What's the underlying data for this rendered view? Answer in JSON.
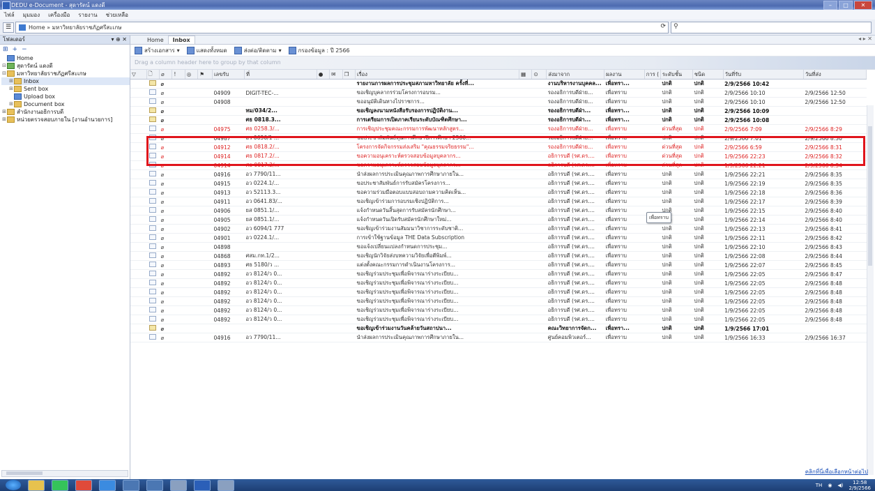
{
  "window": {
    "title": "DEDU e-Document - สุดารัตน์ แดงดี"
  },
  "menu": [
    "ไฟล์",
    "มุมมอง",
    "เครื่องมือ",
    "รายงาน",
    "ช่วยเหลือ"
  ],
  "address": {
    "path": "Home » มหาวิทยาลัยราชภัฏศรีสะเกษ",
    "search_placeholder": ""
  },
  "sidebar": {
    "title": "โฟลเดอร์",
    "tree": [
      {
        "label": "Home",
        "level": 0,
        "type": "home"
      },
      {
        "label": "สุดารัตน์ แดงดี",
        "level": 0,
        "type": "user"
      },
      {
        "label": "มหาวิทยาลัยราชภัฏศรีสะเกษ",
        "level": 0,
        "type": "org"
      },
      {
        "label": "Inbox",
        "level": 1,
        "type": "folder",
        "selected": true
      },
      {
        "label": "Sent box",
        "level": 1,
        "type": "folder"
      },
      {
        "label": "Upload box",
        "level": 1,
        "type": "folder"
      },
      {
        "label": "Document box",
        "level": 1,
        "type": "folder"
      },
      {
        "label": "สำนักงานอธิการบดี",
        "level": 0,
        "type": "org"
      },
      {
        "label": "หน่วยตรวจสอบภายใน [งานอำนวยการ]",
        "level": 0,
        "type": "org"
      }
    ]
  },
  "tabs": [
    {
      "label": "Home"
    },
    {
      "label": "Inbox"
    }
  ],
  "toolbar": {
    "action1": "สร้างเอกสาร",
    "action2": "แสดงทั้งหมด",
    "action3": "ส่งต่อ/ติดตาม",
    "action4": "กรองข้อมูล : ปี 2566"
  },
  "group_hint": "Drag a column header here to group by that column",
  "columns": [
    "",
    "",
    "",
    "!",
    "",
    "",
    "เลขรับ",
    "ที่",
    "",
    "",
    "",
    "เรื่อง",
    "",
    "",
    "ส่งมาจาก",
    "ผลงาน",
    "การ (",
    "ระดับชั้น",
    "ชนิด",
    "วันที่รับ",
    "วันที่ส่ง"
  ],
  "rows": [
    {
      "style": "bold",
      "icon": "open",
      "regno": "",
      "docno": "",
      "subject": "รายงานการผลการประชุมสภามหาวิทยาลัย ครั้งที่...",
      "from": "งานบริหารงานบุคคล...",
      "dept": "เพื่อทรา...",
      "level": "ปกติ",
      "type": "ปกติ",
      "recv": "2/9/2566 10:42",
      "sent": ""
    },
    {
      "style": "",
      "icon": "mail",
      "regno": "04909",
      "docno": "DIGIT-TEC-...",
      "subject": "ขอเชิญบุคลากรร่วมโครงการอบรม...",
      "from": "รองอธิการบดีฝ่าย...",
      "dept": "เพื่อทราบ",
      "level": "ปกติ",
      "type": "ปกติ",
      "recv": "2/9/2566 10:10",
      "sent": "2/9/2566 12:50"
    },
    {
      "style": "",
      "icon": "mail",
      "regno": "04908",
      "docno": "",
      "subject": "ขออนุมัติเดินทางไปราชการ...",
      "from": "รองอธิการบดีฝ่าย...",
      "dept": "เพื่อทราบ",
      "level": "ปกติ",
      "type": "ปกติ",
      "recv": "2/9/2566 10:10",
      "sent": "2/9/2566 12:50"
    },
    {
      "style": "bold",
      "icon": "open",
      "regno": "",
      "docno": "ทม/034/2...",
      "subject": "ขอเชิญลงนามหนังสือรับรองการปฏิบัติงาน...",
      "from": "รองอธิการบดีฝ่า...",
      "dept": "เพื่อทรา...",
      "level": "ปกติ",
      "type": "ปกติ",
      "recv": "2/9/2566 10:09",
      "sent": ""
    },
    {
      "style": "bold",
      "icon": "open",
      "regno": "",
      "docno": "ศธ 0818.3...",
      "subject": "การเตรียมการเปิดภาคเรียนระดับบัณฑิตศึกษา...",
      "from": "รองอธิการบดีฝ่า...",
      "dept": "เพื่อทรา...",
      "level": "ปกติ",
      "type": "ปกติ",
      "recv": "2/9/2566 10:08",
      "sent": ""
    },
    {
      "style": "red",
      "icon": "mail",
      "regno": "04975",
      "docno": "ศธ 0258.3/...",
      "subject": "การเชิญประชุมคณะกรรมการพัฒนาหลักสูตร...",
      "from": "รองอธิการบดีฝ่าย...",
      "dept": "เพื่อทราบ",
      "level": "ด่วนที่สุด",
      "type": "ปกติ",
      "recv": "2/9/2566 7:09",
      "sent": "2/9/2566 8:29"
    },
    {
      "style": "",
      "icon": "mail",
      "regno": "04987",
      "docno": "อว 0636/1 ...",
      "subject": "ขอประชาสัมพันธ์ทุนการศึกษาปีการศึกษา 2566...",
      "from": "รองอธิการบดีฝ่าย...",
      "dept": "เพื่อทราบ",
      "level": "ปกติ",
      "type": "ปกติ",
      "recv": "2/9/2566 7:01",
      "sent": "2/9/2566 8:30"
    },
    {
      "style": "red",
      "icon": "mail",
      "regno": "04912",
      "docno": "ศธ 0818.2/...",
      "subject": "โครงการจัดกิจกรรมส่งเสริม \"คุณธรรมจริยธรรม\"...",
      "from": "รองอธิการบดีฝ่าย...",
      "dept": "เพื่อทราบ",
      "level": "ด่วนที่สุด",
      "type": "ปกติ",
      "recv": "2/9/2566 6:59",
      "sent": "2/9/2566 8:31"
    },
    {
      "style": "red",
      "icon": "mail",
      "regno": "04914",
      "docno": "ศธ 0817.2/...",
      "subject": "ขอความอนุเคราะห์ตรวจสอบข้อมูลบุคลากร...",
      "from": "อธิการบดี (รศ.ดร....",
      "dept": "เพื่อทราบ",
      "level": "ด่วนที่สุด",
      "type": "ปกติ",
      "recv": "1/9/2566 22:23",
      "sent": "2/9/2566 8:32"
    },
    {
      "style": "red",
      "icon": "mail",
      "regno": "04914",
      "docno": "ศธ 0817.2/...",
      "subject": "ขอความอนุเคราะห์ตรวจสอบข้อมูลบุคลากร...",
      "from": "อธิการบดี (รศ.ดร....",
      "dept": "เพื่อทราบ",
      "level": "ด่วนที่สุด",
      "type": "ปกติ",
      "recv": "1/9/2566 22:21",
      "sent": "2/9/2566 8:34"
    },
    {
      "style": "",
      "icon": "mail",
      "regno": "04916",
      "docno": "อว 7790/11...",
      "subject": "นำส่งผลการประเมินคุณภาพการศึกษาภายใน...",
      "from": "อธิการบดี (รศ.ดร....",
      "dept": "เพื่อทราบ",
      "level": "ปกติ",
      "type": "ปกติ",
      "recv": "1/9/2566 22:21",
      "sent": "2/9/2566 8:35"
    },
    {
      "style": "",
      "icon": "mail",
      "regno": "04915",
      "docno": "อว 0224.1/...",
      "subject": "ขอประชาสัมพันธ์การรับสมัครโครงการ...",
      "from": "อธิการบดี (รศ.ดร....",
      "dept": "เพื่อทราบ",
      "level": "ปกติ",
      "type": "ปกติ",
      "recv": "1/9/2566 22:19",
      "sent": "2/9/2566 8:35"
    },
    {
      "style": "",
      "icon": "mail",
      "regno": "04913",
      "docno": "อว 52113.3...",
      "subject": "ขอความร่วมมือตอบแบบสอบถามความคิดเห็น...",
      "from": "อธิการบดี (รศ.ดร....",
      "dept": "เพื่อทราบ",
      "level": "ปกติ",
      "type": "ปกติ",
      "recv": "1/9/2566 22:18",
      "sent": "2/9/2566 8:36"
    },
    {
      "style": "",
      "icon": "mail",
      "regno": "04911",
      "docno": "อว 0641.83/...",
      "subject": "ขอเชิญเข้าร่วมการอบรมเชิงปฏิบัติการ...",
      "from": "อธิการบดี (รศ.ดร....",
      "dept": "เพื่อทราบ",
      "level": "ปกติ",
      "type": "ปกติ",
      "recv": "1/9/2566 22:17",
      "sent": "2/9/2566 8:39"
    },
    {
      "style": "",
      "icon": "mail",
      "regno": "04906",
      "docno": "ยส 0851.1/...",
      "subject": "แจ้งกำหนดวันสิ้นสุดการรับสมัครนักศึกษา...",
      "from": "อธิการบดี (รศ.ดร....",
      "dept": "เพื่อทราบ",
      "level": "ปกติ",
      "type": "ปกติ",
      "recv": "1/9/2566 22:15",
      "sent": "2/9/2566 8:40"
    },
    {
      "style": "",
      "icon": "mail",
      "regno": "04905",
      "docno": "ยส 0851.1/...",
      "subject": "แจ้งกำหนดวันเปิดรับสมัครนักศึกษาใหม่...",
      "from": "อธิการบดี (รศ.ดร....",
      "dept": "เพื่อทราบ",
      "level": "ปกติ",
      "type": "ปกติ",
      "recv": "1/9/2566 22:14",
      "sent": "2/9/2566 8:40"
    },
    {
      "style": "",
      "icon": "mail",
      "regno": "04902",
      "docno": "อว 6094/1 777",
      "subject": "ขอเชิญเข้าร่วมงานสัมมนาวิชาการระดับชาติ...",
      "from": "อธิการบดี (รศ.ดร....",
      "dept": "เพื่อทราบ",
      "level": "ปกติ",
      "type": "ปกติ",
      "recv": "1/9/2566 22:13",
      "sent": "2/9/2566 8:41"
    },
    {
      "style": "",
      "icon": "mail",
      "regno": "04901",
      "docno": "อว 0224.1/...",
      "subject": "การเข้าใช้ฐานข้อมูล THE Data Subscription",
      "from": "อธิการบดี (รศ.ดร....",
      "dept": "เพื่อทราบ",
      "level": "ปกติ",
      "type": "ปกติ",
      "recv": "1/9/2566 22:11",
      "sent": "2/9/2566 8:42"
    },
    {
      "style": "",
      "icon": "mail",
      "regno": "04898",
      "docno": "",
      "subject": "ขอแจ้งเปลี่ยนแปลงกำหนดการประชุม...",
      "from": "อธิการบดี (รศ.ดร....",
      "dept": "เพื่อทราบ",
      "level": "ปกติ",
      "type": "ปกติ",
      "recv": "1/9/2566 22:10",
      "sent": "2/9/2566 8:43"
    },
    {
      "style": "",
      "icon": "mail",
      "regno": "04868",
      "docno": "ศสม.กท.1/2...",
      "subject": "ขอเชิญนักวิจัยส่งบทความวิจัยเพื่อตีพิมพ์...",
      "from": "อธิการบดี (รศ.ดร....",
      "dept": "เพื่อทราบ",
      "level": "ปกติ",
      "type": "ปกติ",
      "recv": "1/9/2566 22:08",
      "sent": "2/9/2566 8:44"
    },
    {
      "style": "",
      "icon": "mail",
      "regno": "04893",
      "docno": "ศธ 5180/ว ...",
      "subject": "แต่งตั้งคณะกรรมการดำเนินงานโครงการ...",
      "from": "อธิการบดี (รศ.ดร....",
      "dept": "เพื่อทราบ",
      "level": "ปกติ",
      "type": "ปกติ",
      "recv": "1/9/2566 22:07",
      "sent": "2/9/2566 8:45"
    },
    {
      "style": "",
      "icon": "mail",
      "regno": "04892",
      "docno": "อว 8124/ว 0...",
      "subject": "ขอเชิญร่วมประชุมเพื่อพิจารณาร่างระเบียบ...",
      "from": "อธิการบดี (รศ.ดร....",
      "dept": "เพื่อทราบ",
      "level": "ปกติ",
      "type": "ปกติ",
      "recv": "1/9/2566 22:05",
      "sent": "2/9/2566 8:47"
    },
    {
      "style": "",
      "icon": "mail",
      "regno": "04892",
      "docno": "อว 8124/ว 0...",
      "subject": "ขอเชิญร่วมประชุมเพื่อพิจารณาร่างระเบียบ...",
      "from": "อธิการบดี (รศ.ดร....",
      "dept": "เพื่อทราบ",
      "level": "ปกติ",
      "type": "ปกติ",
      "recv": "1/9/2566 22:05",
      "sent": "2/9/2566 8:48"
    },
    {
      "style": "",
      "icon": "mail",
      "regno": "04892",
      "docno": "อว 8124/ว 0...",
      "subject": "ขอเชิญร่วมประชุมเพื่อพิจารณาร่างระเบียบ...",
      "from": "อธิการบดี (รศ.ดร....",
      "dept": "เพื่อทราบ",
      "level": "ปกติ",
      "type": "ปกติ",
      "recv": "1/9/2566 22:05",
      "sent": "2/9/2566 8:48"
    },
    {
      "style": "",
      "icon": "mail",
      "regno": "04892",
      "docno": "อว 8124/ว 0...",
      "subject": "ขอเชิญร่วมประชุมเพื่อพิจารณาร่างระเบียบ...",
      "from": "อธิการบดี (รศ.ดร....",
      "dept": "เพื่อทราบ",
      "level": "ปกติ",
      "type": "ปกติ",
      "recv": "1/9/2566 22:05",
      "sent": "2/9/2566 8:48"
    },
    {
      "style": "",
      "icon": "mail",
      "regno": "04892",
      "docno": "อว 8124/ว 0...",
      "subject": "ขอเชิญร่วมประชุมเพื่อพิจารณาร่างระเบียบ...",
      "from": "อธิการบดี (รศ.ดร....",
      "dept": "เพื่อทราบ",
      "level": "ปกติ",
      "type": "ปกติ",
      "recv": "1/9/2566 22:05",
      "sent": "2/9/2566 8:48"
    },
    {
      "style": "",
      "icon": "mail",
      "regno": "04892",
      "docno": "อว 8124/ว 0...",
      "subject": "ขอเชิญร่วมประชุมเพื่อพิจารณาร่างระเบียบ...",
      "from": "อธิการบดี (รศ.ดร....",
      "dept": "เพื่อทราบ",
      "level": "ปกติ",
      "type": "ปกติ",
      "recv": "1/9/2566 22:05",
      "sent": "2/9/2566 8:48"
    },
    {
      "style": "bold",
      "icon": "open",
      "regno": "",
      "docno": "",
      "subject": "ขอเชิญเข้าร่วมงานวันคล้ายวันสถาปนา...",
      "from": "คณะวิทยาการจัดก...",
      "dept": "เพื่อทรา...",
      "level": "ปกติ",
      "type": "ปกติ",
      "recv": "1/9/2566 17:01",
      "sent": ""
    },
    {
      "style": "",
      "icon": "mail",
      "regno": "04916",
      "docno": "อว 7790/11...",
      "subject": "นำส่งผลการประเมินคุณภาพการศึกษาภายใน...",
      "from": "ศูนย์คอมพิวเตอร์...",
      "dept": "เพื่อทราบ",
      "level": "ปกติ",
      "type": "ปกติ",
      "recv": "1/9/2566 16:33",
      "sent": "2/9/2566 16:37"
    }
  ],
  "tooltip": "เพื่อทราบ",
  "footer_link": "คลิกที่นี่เพื่อเลือกหน้าต่อไป",
  "taskbar": {
    "time": "12:58",
    "date": "2/9/2566"
  },
  "colors": {
    "highlight": "#e0141c",
    "urgent": "#d22222"
  }
}
